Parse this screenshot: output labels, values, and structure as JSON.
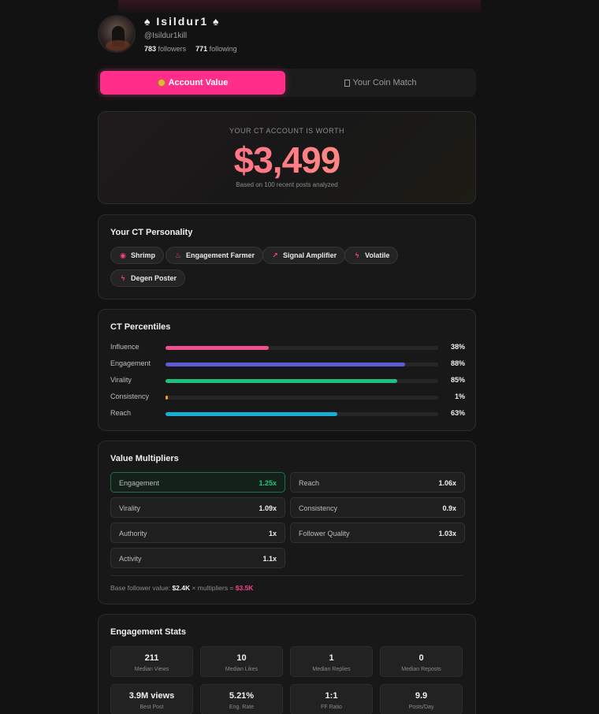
{
  "profile": {
    "name": "♠ Isildur1 ♠",
    "handle": "@Isildur1kill",
    "followers_count": "783",
    "followers_label": "followers",
    "following_count": "771",
    "following_label": "following"
  },
  "tabs": [
    {
      "label": "Account Value",
      "active": true,
      "icon": "money-bag-icon"
    },
    {
      "label": "Your Coin Match",
      "active": false,
      "icon": "missing-glyph-icon"
    }
  ],
  "value": {
    "label": "YOUR CT ACCOUNT IS WORTH",
    "amount": "$3,499",
    "subtitle": "Based on 100 recent posts analyzed"
  },
  "personality": {
    "title": "Your CT Personality",
    "chips": [
      {
        "label": "Shrimp",
        "icon": "eye-icon",
        "glyph": "◉"
      },
      {
        "label": "Engagement Farmer",
        "icon": "flame-icon",
        "glyph": "♨"
      },
      {
        "label": "Signal Amplifier",
        "icon": "trending-up-icon",
        "glyph": "↗"
      },
      {
        "label": "Volatile",
        "icon": "lightning-icon",
        "glyph": "ϟ"
      },
      {
        "label": "Degen Poster",
        "icon": "lightning-icon",
        "glyph": "ϟ"
      }
    ]
  },
  "percentiles": {
    "title": "CT Percentiles",
    "rows": [
      {
        "label": "Influence",
        "value": "38%",
        "fraction": 0.38,
        "color": "#f0508f"
      },
      {
        "label": "Engagement",
        "value": "88%",
        "fraction": 0.88,
        "color": "#5b5bd6"
      },
      {
        "label": "Virality",
        "value": "85%",
        "fraction": 0.85,
        "color": "#1fbf84"
      },
      {
        "label": "Consistency",
        "value": "1%",
        "fraction": 0.01,
        "color": "#f29b28"
      },
      {
        "label": "Reach",
        "value": "63%",
        "fraction": 0.63,
        "color": "#17aed6"
      }
    ]
  },
  "multipliers": {
    "title": "Value Multipliers",
    "items": [
      {
        "label": "Engagement",
        "value": "1.25x",
        "highlight": true
      },
      {
        "label": "Reach",
        "value": "1.06x",
        "highlight": false
      },
      {
        "label": "Virality",
        "value": "1.09x",
        "highlight": false
      },
      {
        "label": "Consistency",
        "value": "0.9x",
        "highlight": false
      },
      {
        "label": "Authority",
        "value": "1x",
        "highlight": false
      },
      {
        "label": "Follower Quality",
        "value": "1.03x",
        "highlight": false
      },
      {
        "label": "Activity",
        "value": "1.1x",
        "highlight": false
      }
    ],
    "footer": {
      "prefix": "Base follower value: ",
      "base": "$2.4K",
      "middle": " × multipliers = ",
      "result": "$3.5K"
    }
  },
  "engagement": {
    "title": "Engagement Stats",
    "stats": [
      {
        "value": "211",
        "label": "Median Views"
      },
      {
        "value": "10",
        "label": "Median Likes"
      },
      {
        "value": "1",
        "label": "Median Replies"
      },
      {
        "value": "0",
        "label": "Median Reposts"
      },
      {
        "value": "3.9M views",
        "label": "Best Post"
      },
      {
        "value": "5.21%",
        "label": "Eng. Rate"
      },
      {
        "value": "1:1",
        "label": "FF Ratio"
      },
      {
        "value": "9.9",
        "label": "Posts/Day"
      }
    ]
  }
}
